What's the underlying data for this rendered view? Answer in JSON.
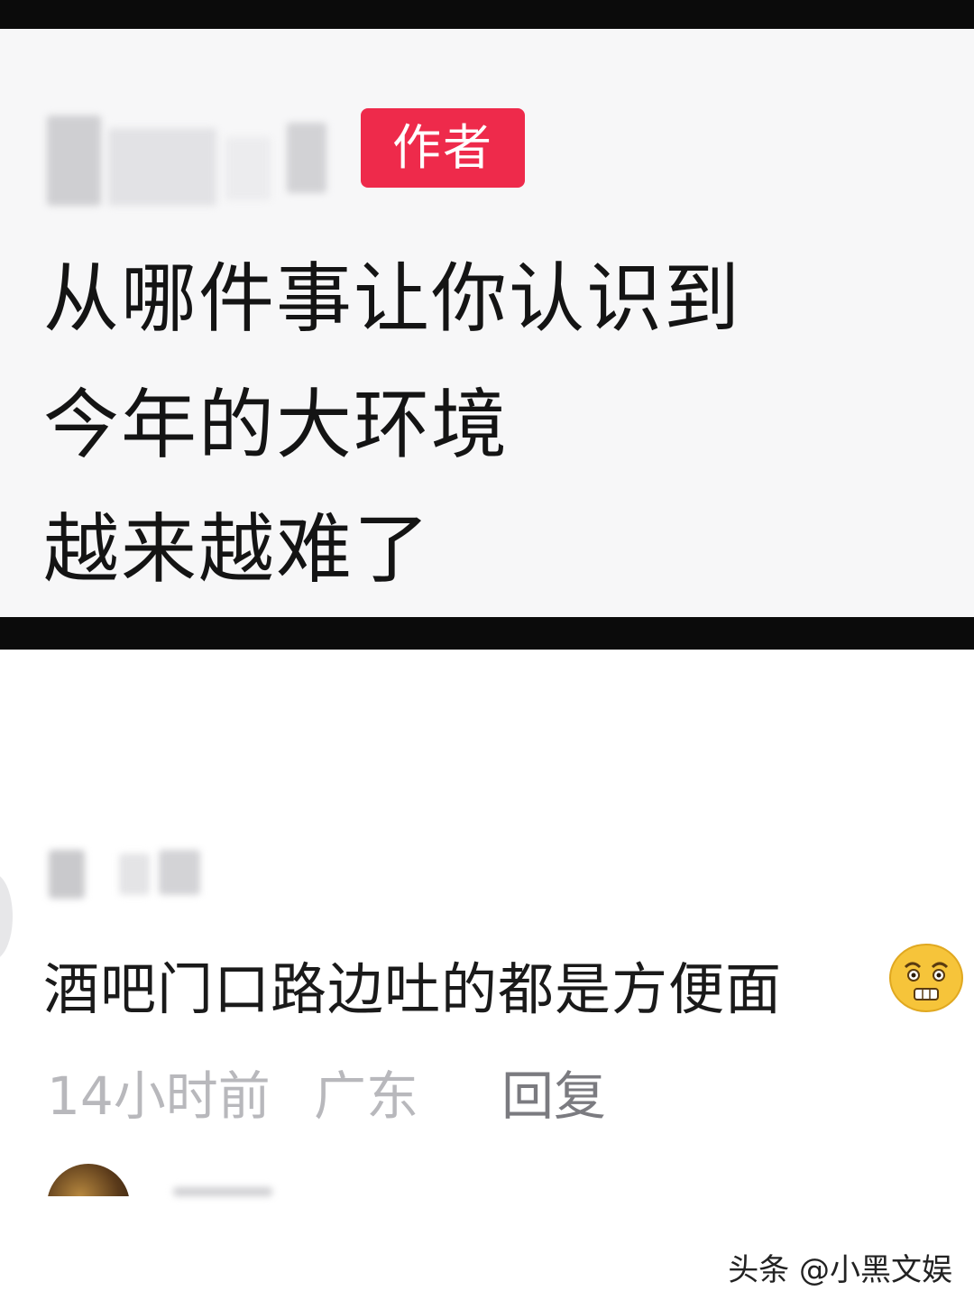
{
  "post": {
    "author_badge": "作者",
    "lines": [
      "从哪件事让你认识到",
      "今年的大环境",
      "越来越难了"
    ]
  },
  "comment": {
    "text": "酒吧门口路边吐的都是方便面",
    "emoji": "embarrassed-face-emoji",
    "time": "14小时前",
    "location": "广东",
    "reply_label": "回复"
  },
  "watermark": "头条 @小黑文娱",
  "colors": {
    "author_badge_bg": "#ee2a4b",
    "text_primary": "#141414",
    "text_meta": "#b8b8bc",
    "reply_text": "#7b7b80"
  }
}
